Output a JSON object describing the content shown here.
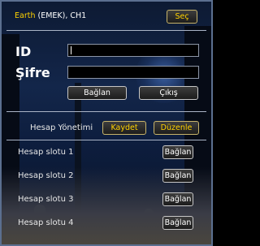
{
  "server": {
    "name": "Earth",
    "detail": " (EMEK),  CH1",
    "select_label": "Seç"
  },
  "login": {
    "id_label": "ID",
    "password_label": "Şifre",
    "id_value": "",
    "password_value": "",
    "connect_label": "Bağlan",
    "exit_label": "Çıkış"
  },
  "accounts": {
    "title": "Hesap Yönetimi",
    "save_label": "Kaydet",
    "edit_label": "Düzenle",
    "slots": [
      {
        "label": "Hesap slotu 1",
        "button": "Bağlan"
      },
      {
        "label": "Hesap slotu 2",
        "button": "Bağlan"
      },
      {
        "label": "Hesap slotu 3",
        "button": "Bağlan"
      },
      {
        "label": "Hesap slotu 4",
        "button": "Bağlan"
      }
    ]
  },
  "colors": {
    "accent": "#ffd200",
    "background": "#13264a"
  }
}
